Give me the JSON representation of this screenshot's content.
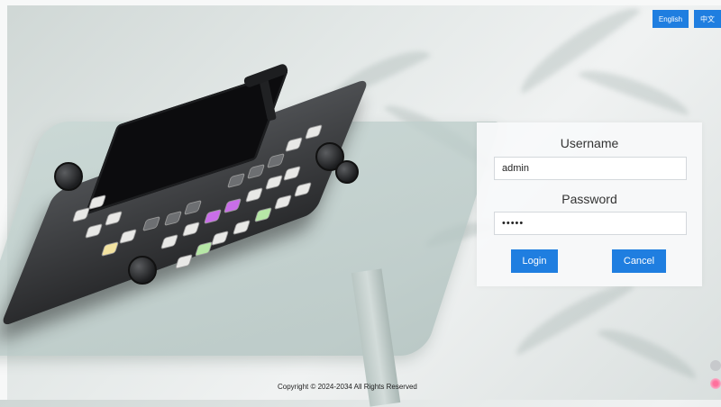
{
  "language_switch": {
    "english_label": "English",
    "chinese_label": "中文"
  },
  "login": {
    "username_label": "Username",
    "username_value": "admin",
    "password_label": "Password",
    "password_value": "•••••",
    "login_button": "Login",
    "cancel_button": "Cancel"
  },
  "footer": {
    "copyright": "Copyright © 2024-2034 All Rights Reserved"
  },
  "colors": {
    "accent": "#1f7ee0"
  },
  "icons": [
    "settings-icon",
    "flower-icon"
  ]
}
